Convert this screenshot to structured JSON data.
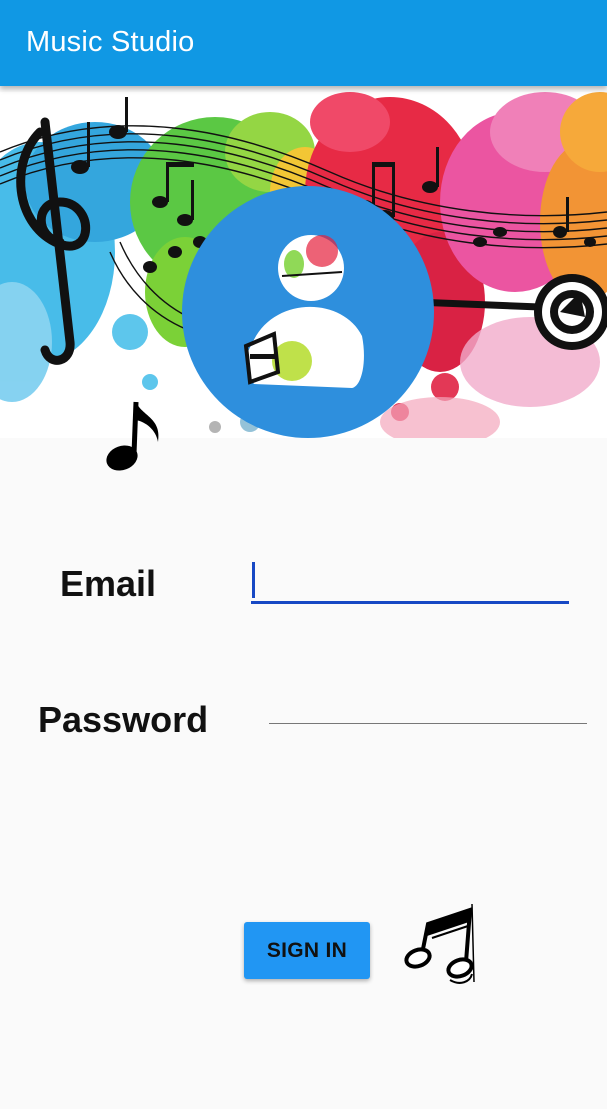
{
  "app_bar": {
    "title": "Music Studio",
    "color": "#1098e4"
  },
  "banner": {
    "description_icon": "music-splash-image",
    "avatar_icon": "user-avatar-icon"
  },
  "form": {
    "email_label": "Email",
    "email_value": "",
    "password_label": "Password",
    "password_value": "",
    "sign_in_label": "SIGN IN",
    "accent_color": "#2196f3",
    "focus_color": "#1748c4"
  },
  "decorations": {
    "left_icon": "eighth-note-icon",
    "right_icon": "beamed-notes-icon"
  }
}
